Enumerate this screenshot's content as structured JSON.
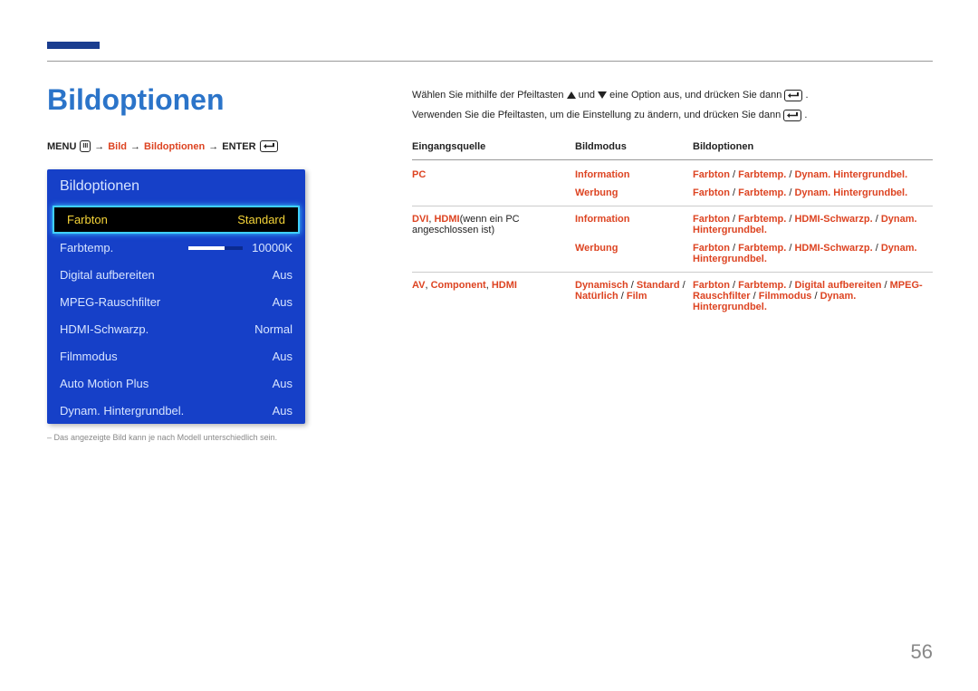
{
  "page_title": "Bildoptionen",
  "breadcrumb": {
    "menu": "MENU",
    "arrow": "→",
    "bild": "Bild",
    "bildoptionen": "Bildoptionen",
    "enter": "ENTER"
  },
  "osd": {
    "title": "Bildoptionen",
    "rows": [
      {
        "label": "Farbton",
        "value": "Standard",
        "selected": true
      },
      {
        "label": "Farbtemp.",
        "value": "10000K",
        "slider": true
      },
      {
        "label": "Digital aufbereiten",
        "value": "Aus"
      },
      {
        "label": "MPEG-Rauschfilter",
        "value": "Aus"
      },
      {
        "label": "HDMI-Schwarzp.",
        "value": "Normal"
      },
      {
        "label": "Filmmodus",
        "value": "Aus"
      },
      {
        "label": "Auto Motion Plus",
        "value": "Aus"
      },
      {
        "label": "Dynam. Hintergrundbel.",
        "value": "Aus"
      }
    ]
  },
  "footnote": "Das angezeigte Bild kann je nach Modell unterschiedlich sein.",
  "instructions": {
    "line1_a": "Wählen Sie mithilfe der Pfeiltasten ",
    "line1_b": " und ",
    "line1_c": " eine Option aus, und drücken Sie dann ",
    "line1_d": ".",
    "line2_a": "Verwenden Sie die Pfeiltasten, um die Einstellung zu ändern, und drücken Sie dann ",
    "line2_b": "."
  },
  "table": {
    "headers": [
      "Eingangsquelle",
      "Bildmodus",
      "Bildoptionen"
    ],
    "rows": [
      {
        "c1": [
          {
            "t": "PC",
            "hl": true
          }
        ],
        "c2": [
          {
            "t": "Information",
            "hl": true
          }
        ],
        "c3": [
          {
            "t": "Farbton",
            "hl": true
          },
          {
            "t": " / "
          },
          {
            "t": "Farbtemp.",
            "hl": true
          },
          {
            "t": " / "
          },
          {
            "t": "Dynam. Hintergrundbel.",
            "hl": true
          }
        ]
      },
      {
        "c1": [],
        "c2": [
          {
            "t": "Werbung",
            "hl": true
          }
        ],
        "c3": [
          {
            "t": "Farbton",
            "hl": true
          },
          {
            "t": " / "
          },
          {
            "t": "Farbtemp.",
            "hl": true
          },
          {
            "t": " / "
          },
          {
            "t": "Dynam. Hintergrundbel.",
            "hl": true
          }
        ]
      },
      {
        "c1": [
          {
            "t": "DVI",
            "hl": true
          },
          {
            "t": ", "
          },
          {
            "t": "HDMI",
            "hl": true
          },
          {
            "t": "(wenn ein PC angeschlossen ist)"
          }
        ],
        "c2": [
          {
            "t": "Information",
            "hl": true
          }
        ],
        "c3": [
          {
            "t": "Farbton",
            "hl": true
          },
          {
            "t": " / "
          },
          {
            "t": "Farbtemp.",
            "hl": true
          },
          {
            "t": " / "
          },
          {
            "t": "HDMI-Schwarzp.",
            "hl": true
          },
          {
            "t": " / "
          },
          {
            "t": "Dynam. Hintergrundbel.",
            "hl": true
          }
        ]
      },
      {
        "c1": [],
        "c2": [
          {
            "t": "Werbung",
            "hl": true
          }
        ],
        "c3": [
          {
            "t": "Farbton",
            "hl": true
          },
          {
            "t": " / "
          },
          {
            "t": "Farbtemp.",
            "hl": true
          },
          {
            "t": " / "
          },
          {
            "t": "HDMI-Schwarzp.",
            "hl": true
          },
          {
            "t": " / "
          },
          {
            "t": "Dynam. Hintergrundbel.",
            "hl": true
          }
        ]
      },
      {
        "c1": [
          {
            "t": "AV",
            "hl": true
          },
          {
            "t": ", "
          },
          {
            "t": "Component",
            "hl": true
          },
          {
            "t": ", "
          },
          {
            "t": "HDMI",
            "hl": true
          }
        ],
        "c2": [
          {
            "t": "Dynamisch",
            "hl": true
          },
          {
            "t": " / "
          },
          {
            "t": "Standard",
            "hl": true
          },
          {
            "t": " / "
          },
          {
            "t": "Natürlich",
            "hl": true
          },
          {
            "t": " / "
          },
          {
            "t": "Film",
            "hl": true
          }
        ],
        "c3": [
          {
            "t": "Farbton",
            "hl": true
          },
          {
            "t": " / "
          },
          {
            "t": "Farbtemp.",
            "hl": true
          },
          {
            "t": " / "
          },
          {
            "t": "Digital aufbereiten",
            "hl": true
          },
          {
            "t": " / "
          },
          {
            "t": "MPEG-Rauschfilter",
            "hl": true
          },
          {
            "t": " / "
          },
          {
            "t": "Filmmodus",
            "hl": true
          },
          {
            "t": " / "
          },
          {
            "t": "Dynam. Hintergrundbel.",
            "hl": true
          }
        ]
      }
    ]
  },
  "page_number": "56"
}
